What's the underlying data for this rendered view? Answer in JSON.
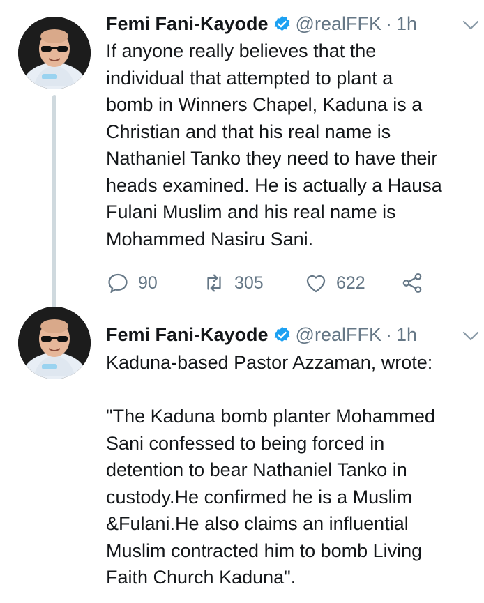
{
  "tweets": [
    {
      "name": "Femi Fani-Kayode",
      "handle": "@realFFK",
      "separator": "·",
      "time": "1h",
      "text": "If anyone really believes that the\nindividual that attempted to plant a\nbomb in Winners Chapel, Kaduna is a\nChristian and that his real name is\nNathaniel Tanko they need to have their\nheads examined. He is actually a Hausa\nFulani Muslim and his real name is\nMohammed Nasiru Sani.",
      "replies": "90",
      "retweets": "305",
      "likes": "622"
    },
    {
      "name": "Femi Fani-Kayode",
      "handle": "@realFFK",
      "separator": "·",
      "time": "1h",
      "text": "Kaduna-based Pastor Azzaman, wrote:\n\n\"The Kaduna bomb planter Mohammed\nSani confessed to being forced in\ndetention to bear Nathaniel Tanko in\ncustody.He confirmed he is a Muslim\n&Fulani.He also claims an influential\nMuslim contracted him to bomb Living\nFaith Church Kaduna\"."
    }
  ],
  "icons": {
    "verified": "verified-badge-icon",
    "caret": "chevron-down-icon",
    "reply": "reply-icon",
    "retweet": "retweet-icon",
    "like": "heart-icon",
    "share": "share-icon"
  },
  "colors": {
    "verified": "#1da1f2",
    "secondary_text": "#657786",
    "thread_line": "#cfd9de"
  }
}
